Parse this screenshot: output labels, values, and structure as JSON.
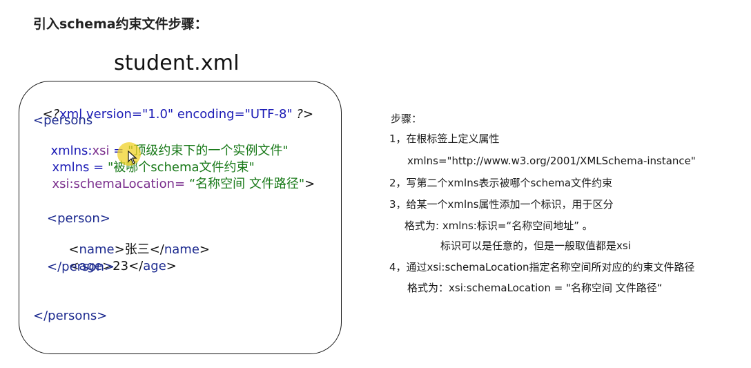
{
  "heading": "引入schema约束文件步骤：",
  "filename": "student.xml",
  "code": {
    "decl_open": "<?",
    "decl_body": "xml version=\"1.0\" encoding=\"UTF-8\" ",
    "decl_close": "?>",
    "persons_open": "<persons",
    "line_xsi_prefix": "xmlns:",
    "line_xsi_attr": "xsi",
    "line_xsi_eq": " = ",
    "line_xsi_value": "\"顶级约束下的一个实例文件\"",
    "line_xmlns_attr": "xmlns = ",
    "line_xmlns_value": "\"被哪个schema文件约束\"",
    "line_loc_attr": "xsi:schemaLocation= ",
    "line_loc_value": "“名称空间 文件路径\"",
    "line_loc_end": ">",
    "person_open": "<person>",
    "name_open_lt": "<",
    "name_tag": "name",
    "name_open_gt": ">",
    "name_text": "张三",
    "name_close_lt": "</",
    "name_close_gt": ">",
    "age_open_lt": "<",
    "age_tag": "age",
    "age_open_gt": ">",
    "age_text": "23",
    "age_close_lt": "</",
    "age_close_gt": ">",
    "person_close": "</person>",
    "persons_close": "</persons>"
  },
  "steps": {
    "title": "步骤：",
    "s1": "1，在根标签上定义属性",
    "s1_detail": "xmlns=\"http://www.w3.org/2001/XMLSchema-instance\"",
    "s2": "2，写第二个xmlns表示被哪个schema文件约束",
    "s3": "3，给某一个xmlns属性添加一个标识，用于区分",
    "s3_format": "格式为: xmlns:标识=“名称空间地址” 。",
    "s3_note": "标识可以是任意的，但是一般取值都是xsi",
    "s4": "4，通过xsi:schemaLocation指定名称空间所对应的约束文件路径",
    "s4_format": "格式为：xsi:schemaLocation = \"名称空间  文件路径“"
  },
  "colors": {
    "tag": "#1c2a8f",
    "attr_purple": "#7a2d8c",
    "string_green": "#1a7a1a",
    "highlight": "#f0d228"
  }
}
